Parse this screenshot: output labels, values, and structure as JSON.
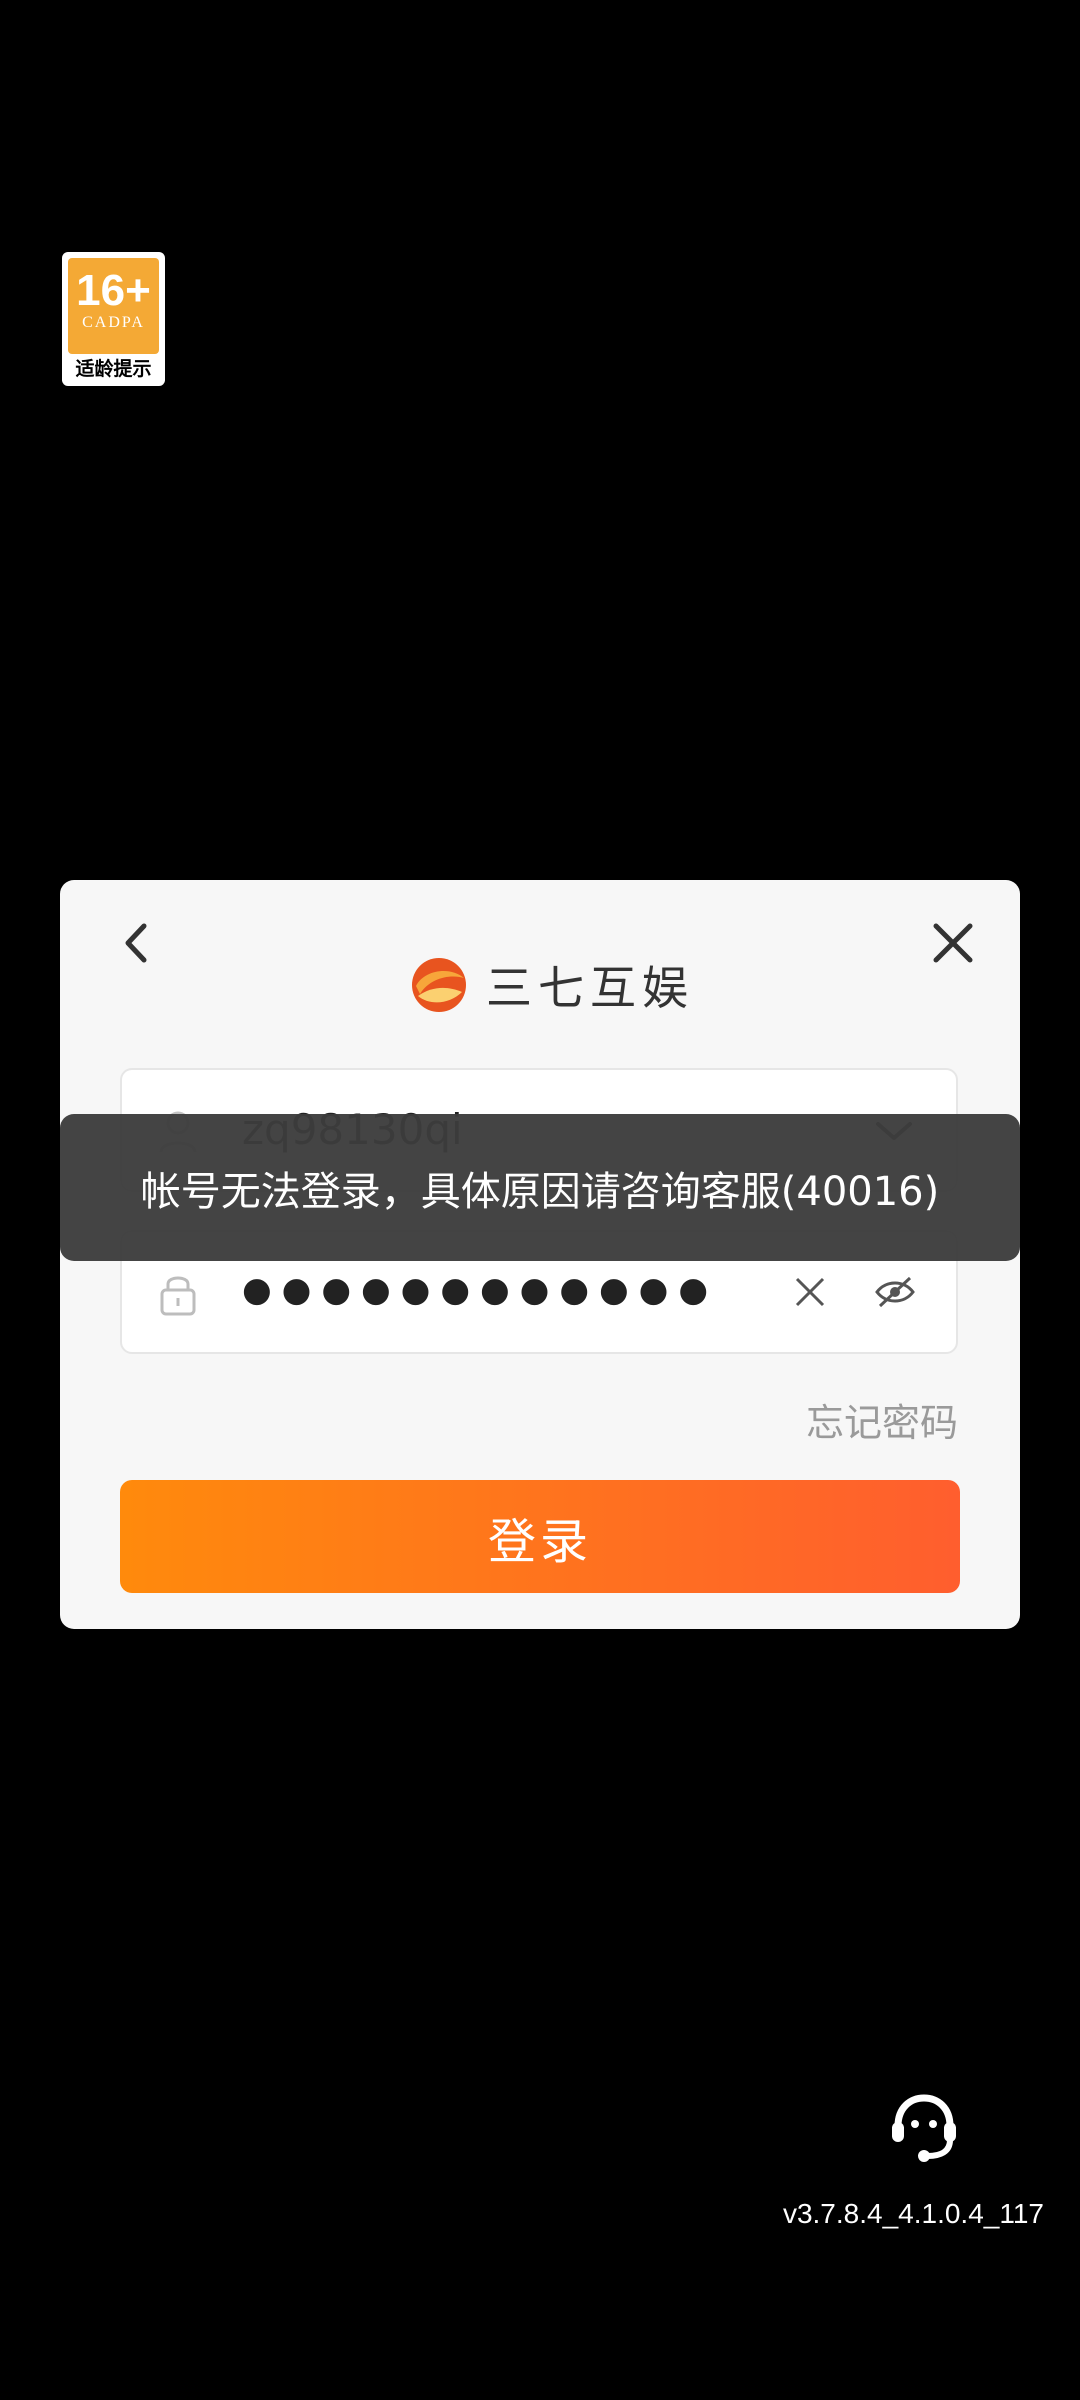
{
  "age_badge": {
    "rating": "16+",
    "org": "CADPA",
    "caption": "适龄提示"
  },
  "dialog": {
    "brand_name": "三七互娱",
    "username": "zq98130qi",
    "password_masked": "●●●●●●●●●●●●",
    "forgot_label": "忘记密码",
    "login_label": "登录"
  },
  "toast": {
    "message": "帐号无法登录，具体原因请咨询客服(40016)"
  },
  "footer": {
    "version": "v3.7.8.4_4.1.0.4_117"
  },
  "colors": {
    "accent_start": "#ff8a0c",
    "accent_end": "#ff5e2e",
    "badge": "#f4a935"
  },
  "icons": [
    "back-icon",
    "close-icon",
    "user-icon",
    "chevron-down-icon",
    "lock-icon",
    "clear-icon",
    "eye-hidden-icon",
    "support-icon",
    "brand-logo"
  ]
}
